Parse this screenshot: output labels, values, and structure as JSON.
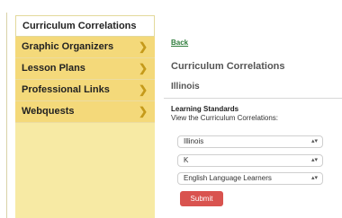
{
  "sidebar": {
    "header": "Curriculum Correlations",
    "items": [
      {
        "label": "Graphic Organizers",
        "icon": "chevron-right-icon"
      },
      {
        "label": "Lesson Plans",
        "icon": "chevron-right-icon"
      },
      {
        "label": "Professional Links",
        "icon": "chevron-right-icon"
      },
      {
        "label": "Webquests",
        "icon": "chevron-right-icon"
      }
    ]
  },
  "main": {
    "back_link": "Back",
    "title": "Curriculum Correlations",
    "subtitle": "Illinois",
    "section_label": "Learning Standards",
    "section_desc": "View the Curriculum Correlations:",
    "selects": [
      {
        "value": "Illinois"
      },
      {
        "value": "K"
      },
      {
        "value": "English Language Learners"
      }
    ],
    "submit_label": "Submit"
  },
  "colors": {
    "sidebar_item_bg": "#f4d97a",
    "chevron": "#c59a1a",
    "link": "#2f7d3c",
    "submit_bg": "#d9534f"
  }
}
